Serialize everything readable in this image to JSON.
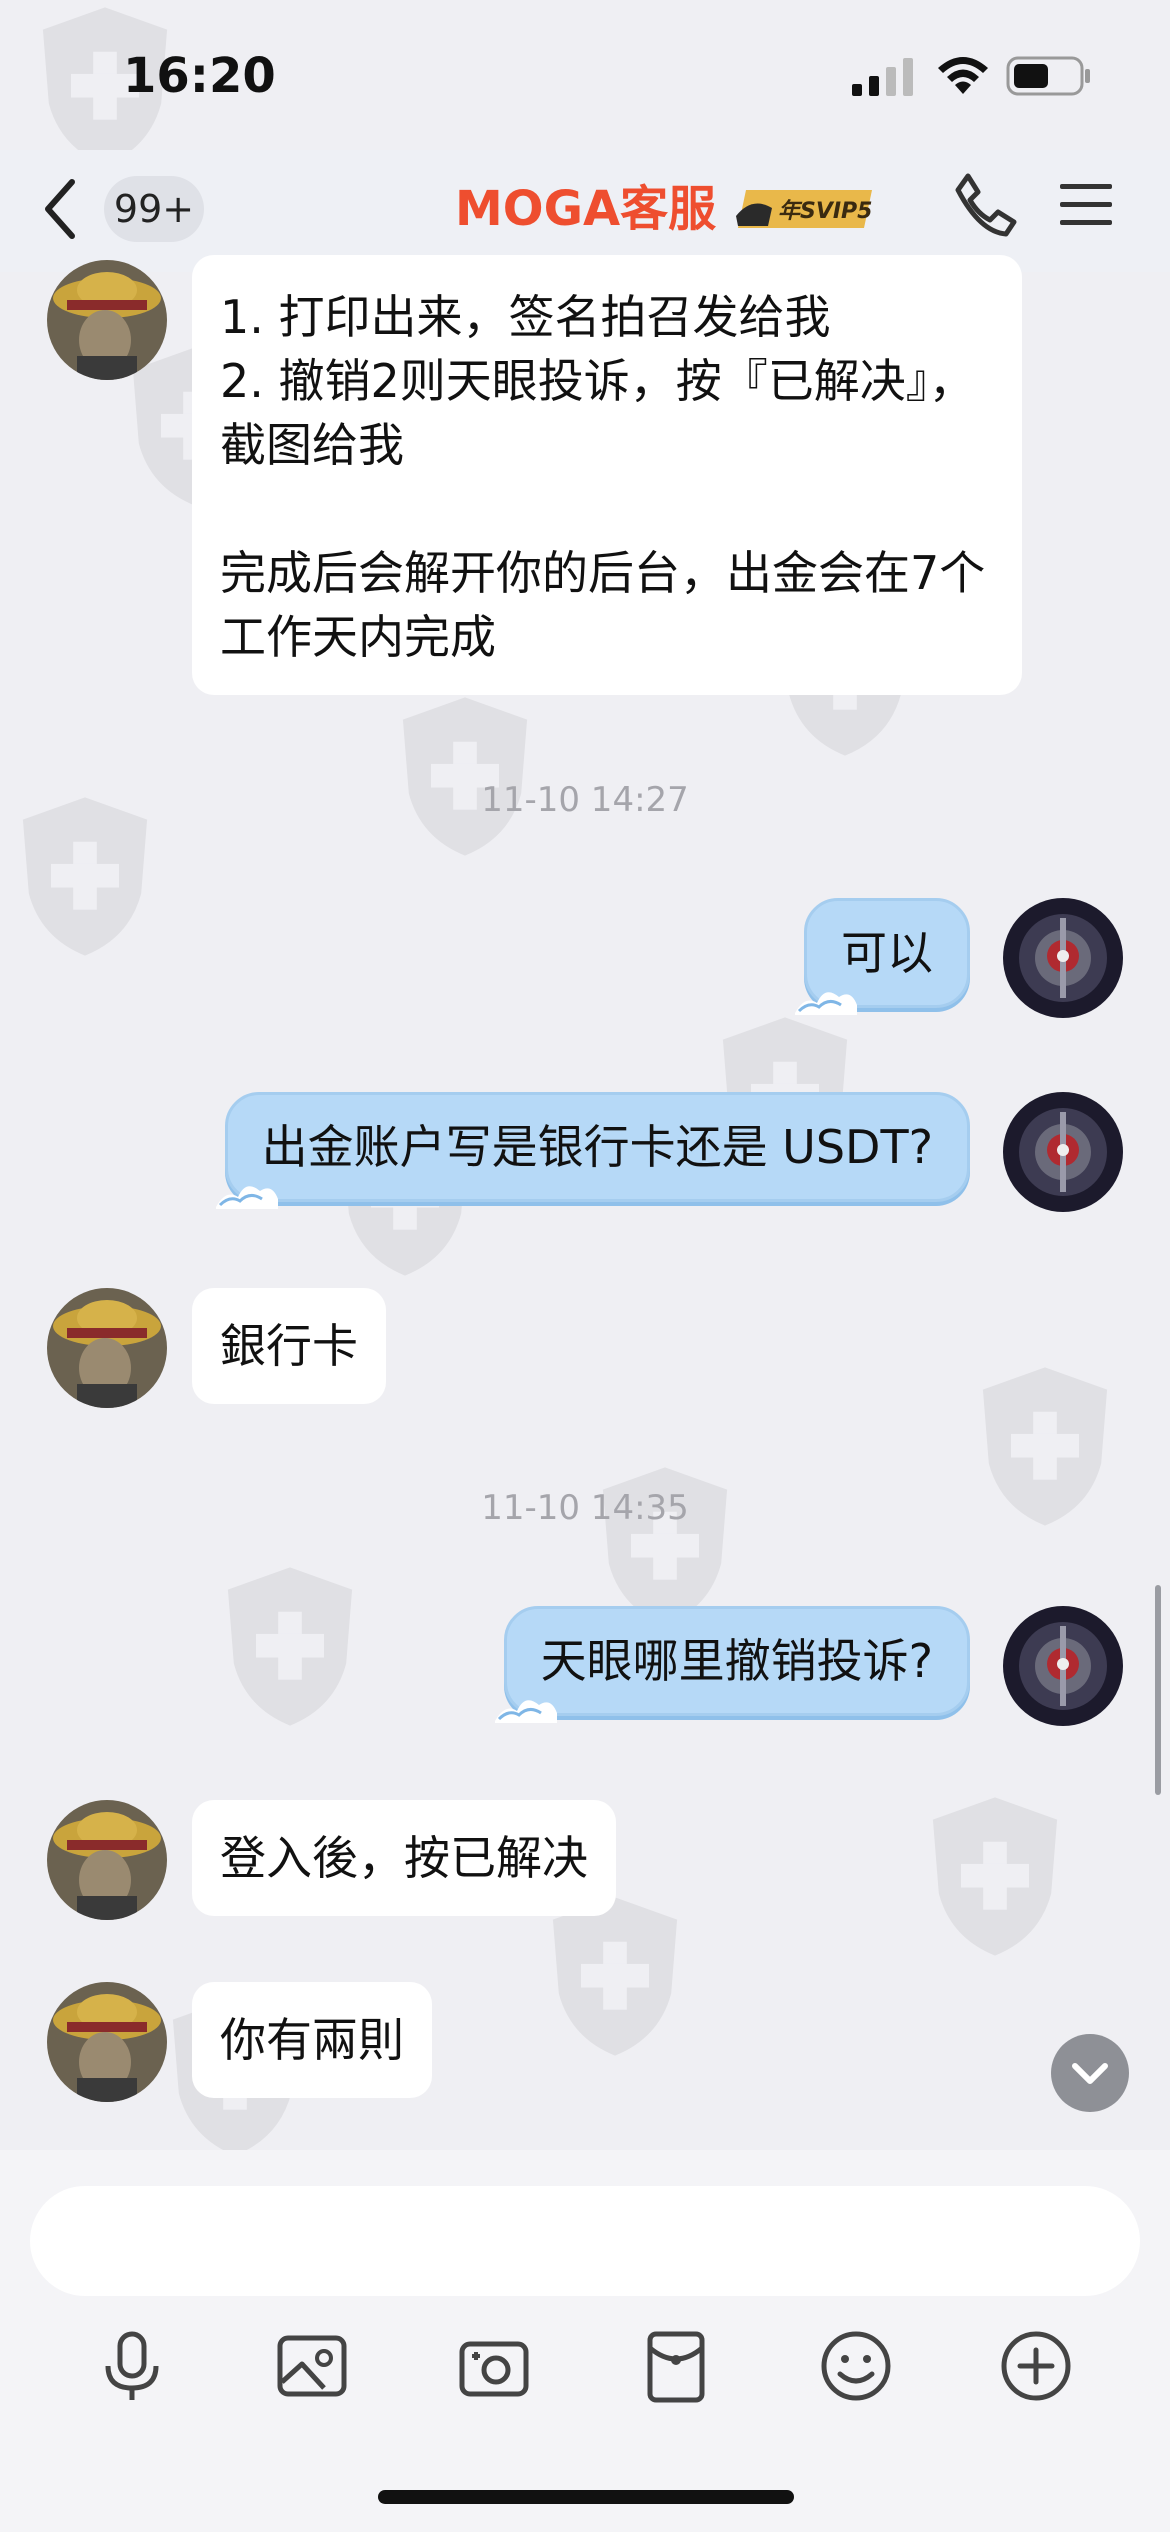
{
  "status_bar": {
    "time": "16:20"
  },
  "header": {
    "back_icon": "chevron-left-icon",
    "unread_count": "99+",
    "title": "MOGA客服",
    "badge_text": "年SVIP5",
    "call_icon": "phone-icon",
    "menu_icon": "menu-icon"
  },
  "messages": [
    {
      "side": "left",
      "text": "1. 打印出来，签名拍召发给我\n2. 撤销2则天眼投诉，按『已解决』，截图给我\n\n完成后会解开你的后台，出金会在7个工作天内完成"
    },
    {
      "type": "timestamp",
      "text": "11-10 14:27"
    },
    {
      "side": "right",
      "text": "可以"
    },
    {
      "side": "right",
      "text": "出金账户写是银行卡还是 USDT?"
    },
    {
      "side": "left",
      "text": "銀行卡"
    },
    {
      "type": "timestamp",
      "text": "11-10 14:35"
    },
    {
      "side": "right",
      "text": "天眼哪里撤销投诉?"
    },
    {
      "side": "left",
      "text": "登入後，按已解决"
    },
    {
      "side": "left",
      "text": "你有兩則"
    }
  ],
  "input": {
    "placeholder": ""
  },
  "toolbar": {
    "icons": [
      "microphone-icon",
      "image-icon",
      "camera-icon",
      "red-packet-icon",
      "emoji-icon",
      "plus-icon"
    ]
  },
  "colors": {
    "title": "#ee4e2f",
    "right_bubble": "#b6d9f7",
    "left_bubble": "#ffffff",
    "background": "#efeff3"
  }
}
